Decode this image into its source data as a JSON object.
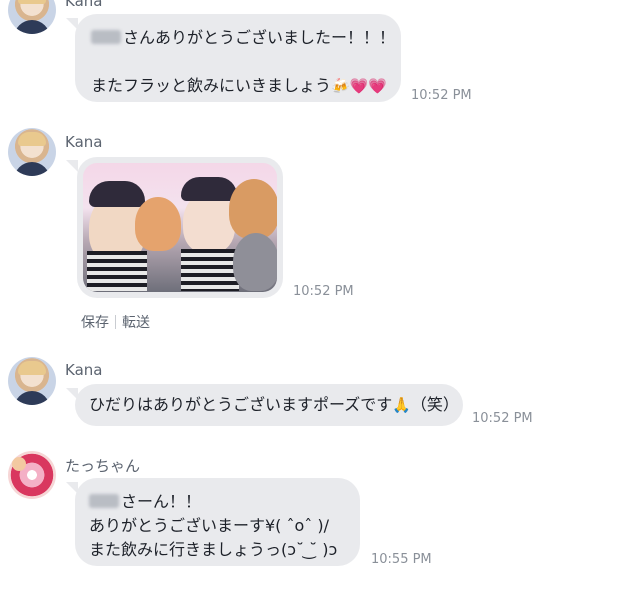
{
  "messages": [
    {
      "sender": "Kana",
      "lines": [
        "さんありがとうございましたー！！！",
        "",
        "またフラッと飲みにいきましょう"
      ],
      "emojis": [
        "🍻",
        "💗",
        "💗"
      ],
      "time": "10:52 PM"
    },
    {
      "sender": "Kana",
      "attachment": "photo",
      "time": "10:52 PM",
      "actions": [
        "保存",
        "転送"
      ]
    },
    {
      "sender": "Kana",
      "text": "ひだりはありがとうございますポーズです",
      "emoji": "🙏",
      "suffix": "（笑）",
      "time": "10:52 PM"
    },
    {
      "sender": "たっちゃん",
      "lines": [
        "さーん！！",
        "ありがとうございまーす¥( ˆoˆ )/",
        "また飲みに行きましょうっ(ↄ˘ ͜˘ )ↄ"
      ],
      "time": "10:55 PM"
    }
  ]
}
